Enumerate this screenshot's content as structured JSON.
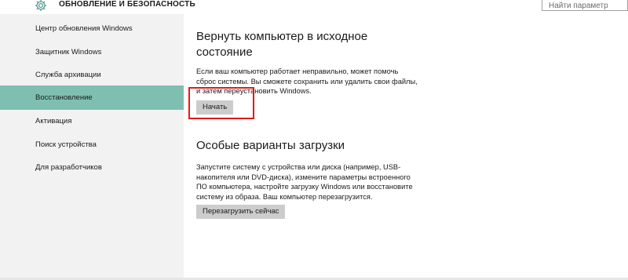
{
  "header": {
    "title": "ОБНОВЛЕНИЕ И БЕЗОПАСНОСТЬ",
    "icon": "gear-icon",
    "search_placeholder": "Найти параметр"
  },
  "sidebar": {
    "items": [
      {
        "label": "Центр обновления Windows",
        "active": false
      },
      {
        "label": "Защитник Windows",
        "active": false
      },
      {
        "label": "Служба архивации",
        "active": false
      },
      {
        "label": "Восстановление",
        "active": true
      },
      {
        "label": "Активация",
        "active": false
      },
      {
        "label": "Поиск устройства",
        "active": false
      },
      {
        "label": "Для разработчиков",
        "active": false
      }
    ]
  },
  "main": {
    "reset": {
      "title": "Вернуть компьютер в исходное состояние",
      "description": "Если ваш компьютер работает неправильно, может помочь\nсброс системы. Вы сможете сохранить или удалить свои файлы,\nи затем переустановить Windows.",
      "button_label": "Начать"
    },
    "advanced": {
      "title": "Особые варианты загрузки",
      "description": "Запустите систему с устройства или диска (например, USB-\nнакопителя или DVD-диска), измените параметры встроенного\nПО компьютера, настройте загрузку Windows или восстановите\nсистему из образа. Ваш компьютер перезагрузится.",
      "button_label": "Перезагрузить сейчас"
    }
  },
  "colors": {
    "accent": "#7fbfb1",
    "sidebar_bg": "#f2f2f2",
    "button_bg": "#cccccc",
    "highlight": "#e11a1a"
  }
}
